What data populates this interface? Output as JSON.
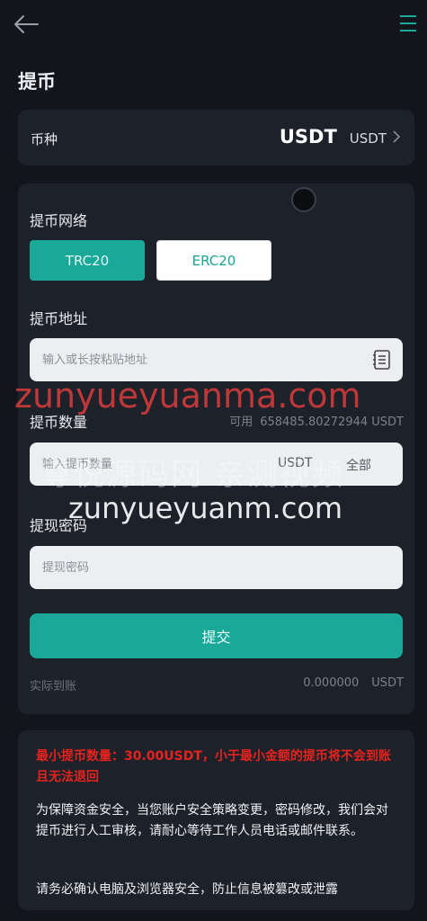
{
  "header": {
    "back_icon": "arrow-left-icon",
    "menu_icon": "menu-lines-icon",
    "title": "提币"
  },
  "coin": {
    "label": "币种",
    "value_big": "USDT",
    "value_small": "USDT"
  },
  "network": {
    "label": "提币网络",
    "options": [
      "TRC20",
      "ERC20"
    ],
    "selected": "TRC20"
  },
  "address": {
    "label": "提币地址",
    "placeholder": "输入或长按粘贴地址"
  },
  "amount": {
    "label": "提币数量",
    "available_label": "可用",
    "available_value": "658485.80272944 USDT",
    "placeholder": "输入提币数量",
    "unit": "USDT",
    "all_label": "全部"
  },
  "password": {
    "label": "提现密码",
    "placeholder": "提现密码"
  },
  "submit_label": "提交",
  "actual": {
    "label": "实际到账",
    "value": "0.000000",
    "unit": "USDT"
  },
  "notices": {
    "warning": "最小提币数量：30.00USDT，小于最小金额的提币将不会到账且无法退回",
    "review": "为保障资金安全，当您账户安全策略变更，密码修改，我们会对提币进行人工审核，请耐心等待工作人员电话或邮件联系。",
    "security": "请务必确认电脑及浏览器安全，防止信息被篡改或泄露"
  },
  "watermark": {
    "line1": "zunyueyuanma.com",
    "line2": "尊悦源码网 亲测视频",
    "line3": "zunyueyuanm.com"
  },
  "colors": {
    "accent": "#1aa899",
    "background": "#12151b",
    "card": "#1d2129",
    "warning": "#e5231e"
  }
}
